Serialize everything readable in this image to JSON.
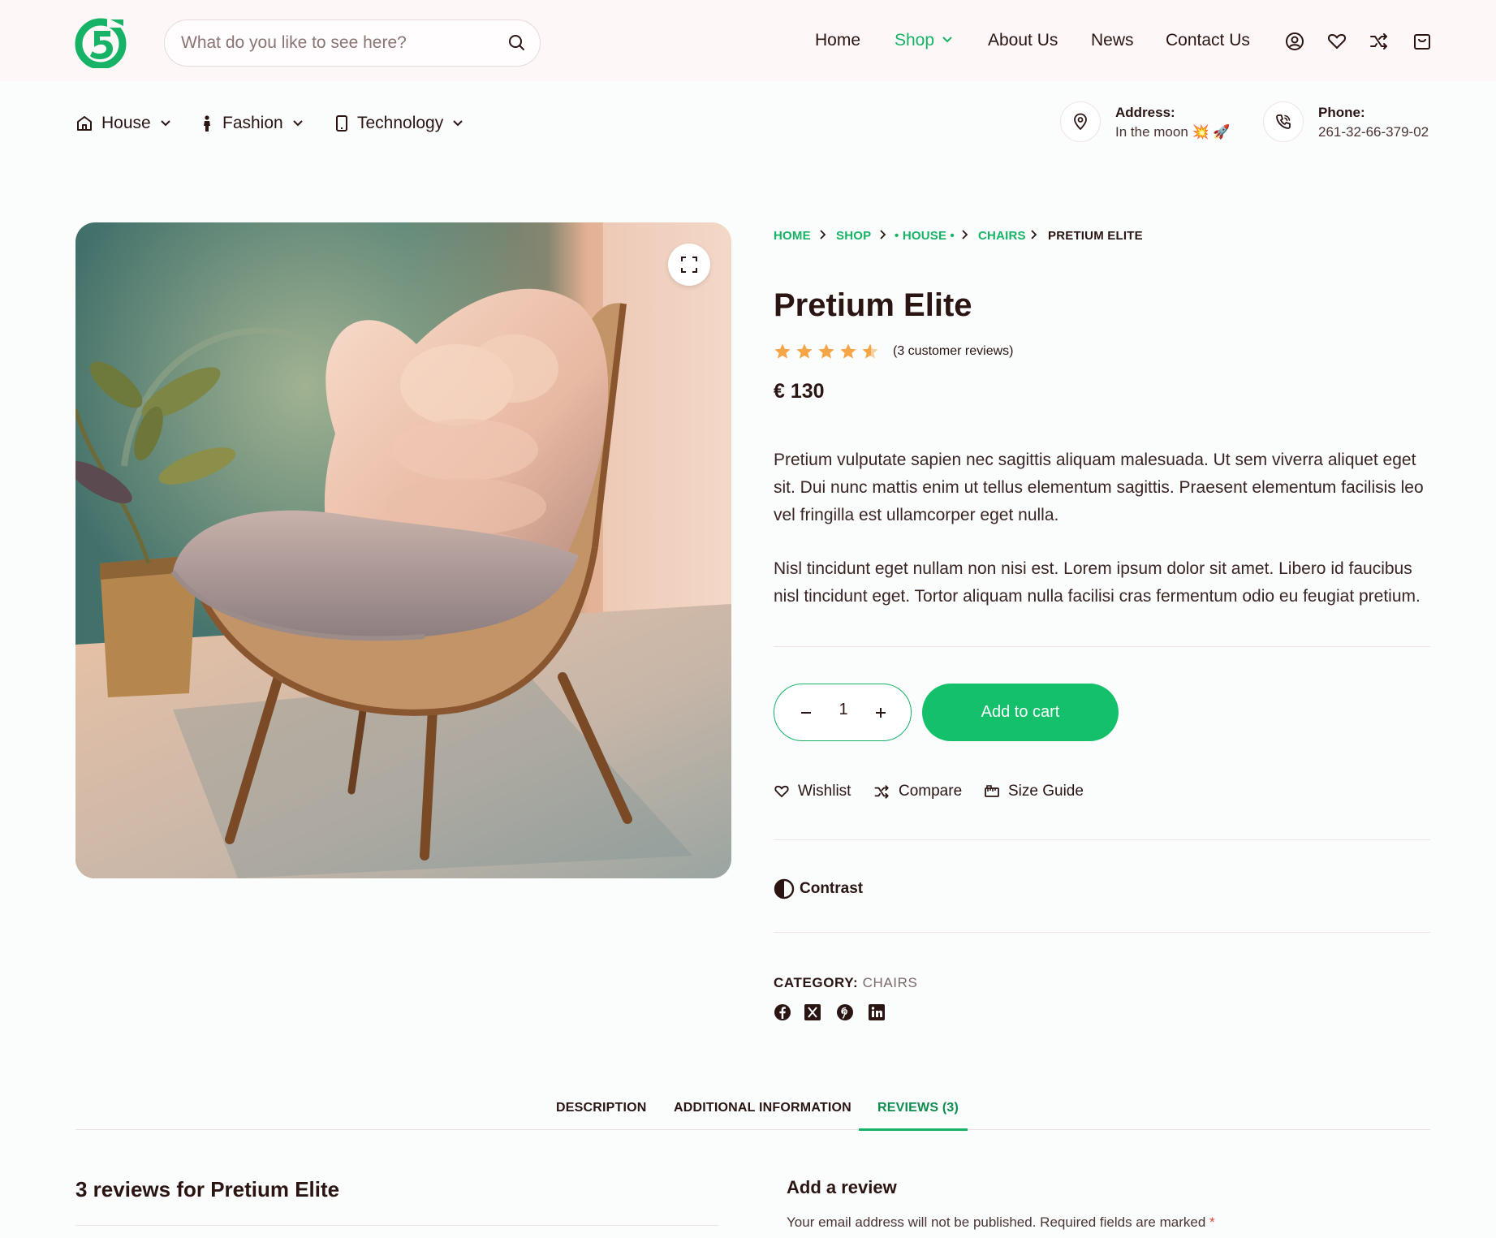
{
  "header": {
    "search": {
      "placeholder": "What do you like to see here?"
    },
    "nav": [
      {
        "label": "Home"
      },
      {
        "label": "Shop"
      },
      {
        "label": "About Us"
      },
      {
        "label": "News"
      },
      {
        "label": "Contact Us"
      }
    ],
    "icons": [
      "user-icon",
      "heart-icon",
      "compare-icon",
      "cart-icon"
    ]
  },
  "categories": [
    {
      "label": "House",
      "icon": "house-icon"
    },
    {
      "label": "Fashion",
      "icon": "person-icon"
    },
    {
      "label": "Technology",
      "icon": "phone-icon"
    }
  ],
  "contact": {
    "address_label": "Address:",
    "address_value": "In the moon 💥 🚀",
    "phone_label": "Phone:",
    "phone_value": "261-32-66-379-02"
  },
  "breadcrumb": [
    "HOME",
    "SHOP",
    "• HOUSE •",
    "CHAIRS",
    "PRETIUM ELITE"
  ],
  "product": {
    "title": "Pretium Elite",
    "rating": 4.5,
    "rating_max": 5,
    "reviews_text": "(3 customer reviews)",
    "price": "€ 130",
    "description": [
      "Pretium vulputate sapien nec sagittis aliquam malesuada. Ut sem viverra aliquet eget sit. Dui nunc mattis enim ut tellus elementum sagittis. Praesent elementum facilisis leo vel fringilla est ullamcorper eget nulla.",
      "Nisl tincidunt eget nullam non nisi est. Lorem ipsum dolor sit amet. Libero id faucibus nisl tincidunt eget. Tortor aliquam nulla facilisi cras fermentum odio eu feugiat pretium."
    ],
    "quantity": "1",
    "add_to_cart": "Add to cart",
    "actions": {
      "wishlist": "Wishlist",
      "compare": "Compare",
      "size_guide": "Size Guide"
    },
    "contrast": "Contrast",
    "category_label": "CATEGORY:",
    "category_value": "CHAIRS",
    "social": [
      "facebook-icon",
      "x-icon",
      "pinterest-icon",
      "linkedin-icon"
    ]
  },
  "tabs": [
    {
      "label": "DESCRIPTION"
    },
    {
      "label": "ADDITIONAL INFORMATION"
    },
    {
      "label": "REVIEWS (3)"
    }
  ],
  "reviews": {
    "heading": "3 reviews for Pretium Elite",
    "add_heading": "Add a review",
    "note": "Your email address will not be published. Required fields are marked",
    "required_mark": "*"
  },
  "colors": {
    "accent": "#16b366",
    "text": "#2a1513",
    "star": "#f5a446"
  }
}
